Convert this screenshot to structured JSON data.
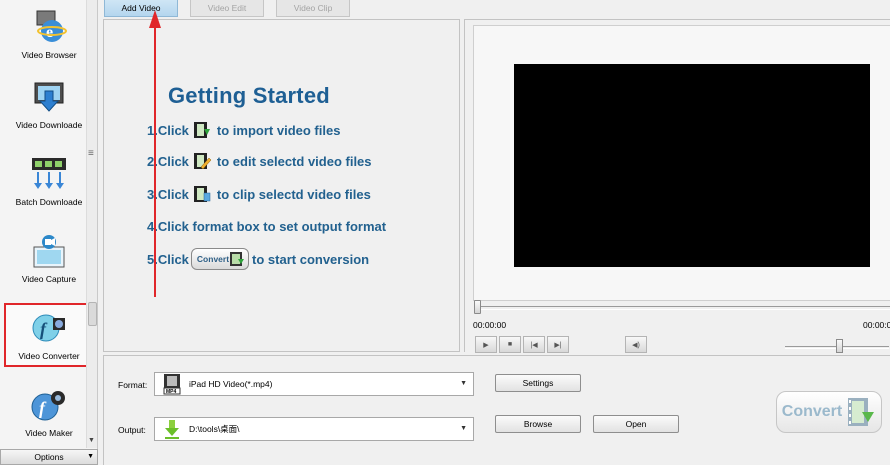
{
  "sidebar": {
    "items": [
      {
        "label": "Video Browser",
        "icon": "video-browser-icon"
      },
      {
        "label": "Video Downloade",
        "icon": "video-download-icon"
      },
      {
        "label": "Batch Downloade",
        "icon": "batch-download-icon"
      },
      {
        "label": "Video Capture",
        "icon": "video-capture-icon"
      },
      {
        "label": "Video Converter",
        "icon": "video-converter-icon"
      },
      {
        "label": "Video Maker",
        "icon": "video-maker-icon"
      }
    ],
    "active_item": "Video Converter",
    "options_label": "Options"
  },
  "tabs": {
    "add_video": "Add Video",
    "video_edit": "Video Edit",
    "video_clip": "Video Clip"
  },
  "getting_started": {
    "title": "Getting Started",
    "steps": [
      {
        "before": "1.Click",
        "icon": "import-video-icon",
        "after": "to import video files"
      },
      {
        "before": "2.Click",
        "icon": "edit-video-icon",
        "after": "to edit selectd video files"
      },
      {
        "before": "3.Click",
        "icon": "clip-video-icon",
        "after": "to clip selectd video files"
      },
      {
        "before": "4.Click format box to set output format"
      },
      {
        "before": "5.Click",
        "button_label": "Convert",
        "after": "to start conversion"
      }
    ]
  },
  "player": {
    "time_current": "00:00:00",
    "time_total": "00:00:0",
    "controls": [
      "play-icon",
      "stop-icon",
      "previous-frame-icon",
      "next-frame-icon"
    ],
    "mute_icon": "speaker-icon",
    "volume": 0.52
  },
  "conversion": {
    "format_label": "Format:",
    "format_value": "iPad HD Video(*.mp4)",
    "format_icon": "mp4-file-icon",
    "output_label": "Output:",
    "output_value": "D:\\tools\\桌面\\",
    "output_icon": "download-arrow-icon",
    "settings_button": "Settings",
    "browse_button": "Browse",
    "open_button": "Open",
    "convert_button": "Convert"
  },
  "colors": {
    "accent_blue": "#22618f",
    "highlight_red": "#e0262a",
    "active_tab": "#b4d6ee"
  }
}
